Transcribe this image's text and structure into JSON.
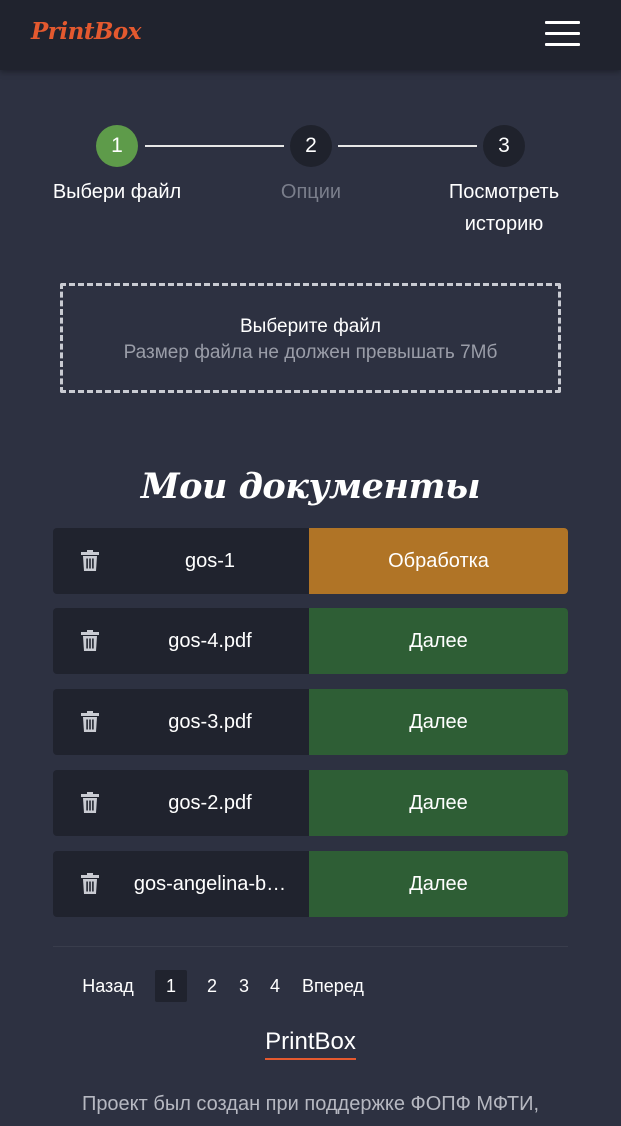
{
  "app": {
    "logo": "PrintBox"
  },
  "steps": [
    {
      "number": "1",
      "label": "Выбери файл",
      "active": true
    },
    {
      "number": "2",
      "label": "Опции",
      "active": false
    },
    {
      "number": "3",
      "label_line1": "Посмотреть",
      "label_line2": "историю",
      "active": false
    }
  ],
  "upload": {
    "title": "Выберите файл",
    "hint": "Размер файла не должен превышать 7Мб"
  },
  "documents": {
    "heading": "Мои документы",
    "items": [
      {
        "name": "gos-1",
        "action": "Обработка",
        "status": "processing"
      },
      {
        "name": "gos-4.pdf",
        "action": "Далее",
        "status": "ready"
      },
      {
        "name": "gos-3.pdf",
        "action": "Далее",
        "status": "ready"
      },
      {
        "name": "gos-2.pdf",
        "action": "Далее",
        "status": "ready"
      },
      {
        "name": "gos-angelina-b…",
        "action": "Далее",
        "status": "ready"
      }
    ]
  },
  "pagination": {
    "prev": "Назад",
    "pages": [
      "1",
      "2",
      "3",
      "4"
    ],
    "current": "1",
    "next": "Вперед"
  },
  "footer": {
    "brand": "PrintBox",
    "text": "Проект был создан при поддержке ФОПФ МФТИ,"
  },
  "colors": {
    "background": "#2d3141",
    "header": "#20232e",
    "accent": "#e4592f",
    "step_active": "#5e9b4a",
    "processing": "#b07426",
    "ready": "#2e5e35"
  }
}
